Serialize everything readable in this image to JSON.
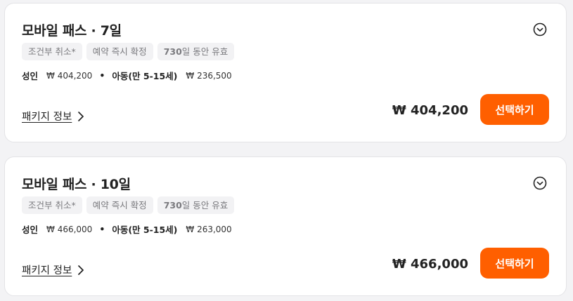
{
  "cards": [
    {
      "title": "모바일 패스 · 7일",
      "chips": [
        {
          "text": "조건부 취소*"
        },
        {
          "text": "예약 즉시 확정"
        },
        {
          "bold": "730",
          "text": "일 동안 유효"
        }
      ],
      "adult_label": "성인",
      "adult_price": "₩ 404,200",
      "separator": "•",
      "child_label": "아동(만 5-15세)",
      "child_price": "₩ 236,500",
      "package_link": "패키지 정보",
      "total": "₩ 404,200",
      "select_label": "선택하기"
    },
    {
      "title": "모바일 패스 · 10일",
      "chips": [
        {
          "text": "조건부 취소*"
        },
        {
          "text": "예약 즉시 확정"
        },
        {
          "bold": "730",
          "text": "일 동안 유효"
        }
      ],
      "adult_label": "성인",
      "adult_price": "₩ 466,000",
      "separator": "•",
      "child_label": "아동(만 5-15세)",
      "child_price": "₩ 263,000",
      "package_link": "패키지 정보",
      "total": "₩ 466,000",
      "select_label": "선택하기"
    }
  ],
  "colors": {
    "accent": "#ff5f00",
    "chip_bg": "#f2f2f4",
    "card_border": "#e3e3e6"
  },
  "icons": {
    "expand": "chevron-down-circle-icon",
    "link_arrow": "chevron-right-icon"
  }
}
